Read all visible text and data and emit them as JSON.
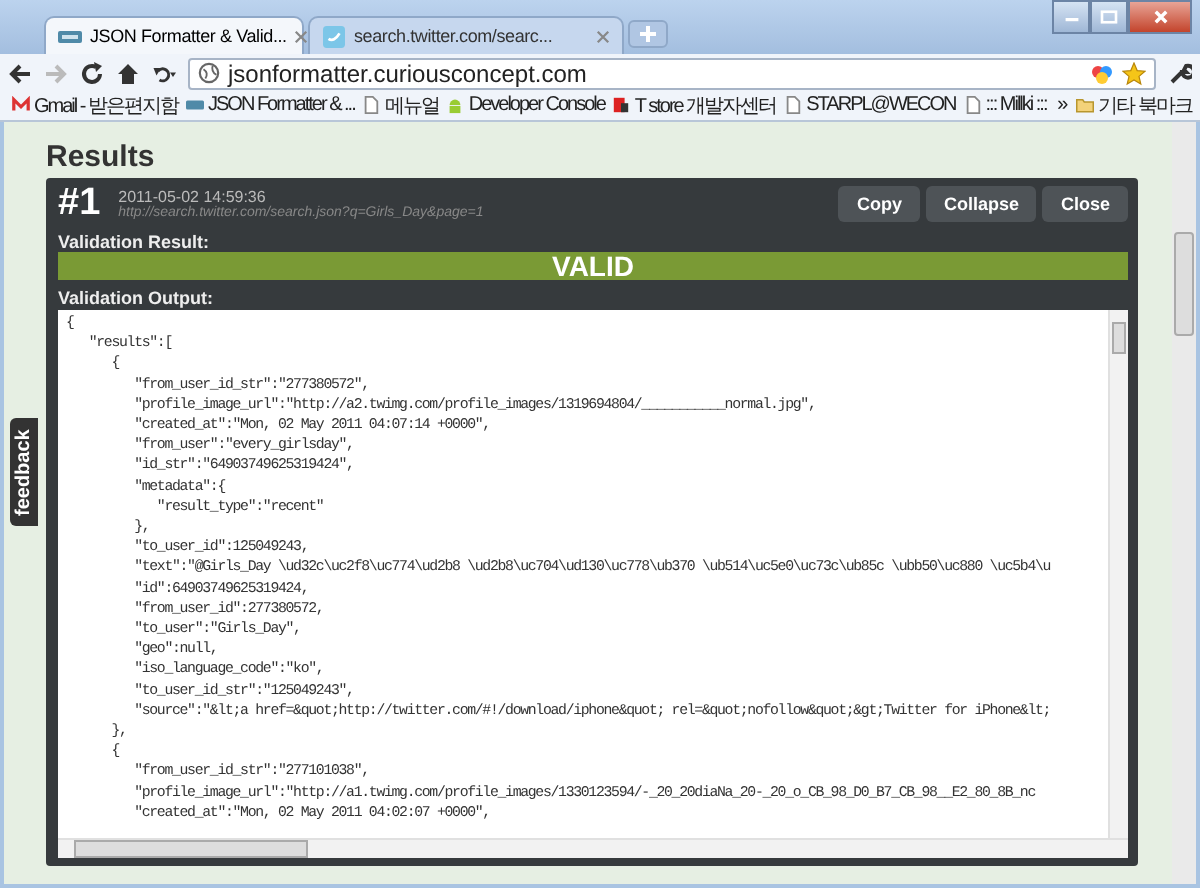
{
  "window": {
    "tabs": [
      {
        "title": "JSON Formatter & Valid...",
        "selected": true
      },
      {
        "title": "search.twitter.com/searc...",
        "selected": false
      }
    ]
  },
  "toolbar": {
    "address": "jsonformatter.curiousconcept.com"
  },
  "bookmarks": {
    "items": [
      "Gmail - 받은편지함",
      "JSON Formatter & ...",
      "메뉴얼",
      "Developer Console",
      "T store 개발자센터",
      "STARPL@WECON",
      "::: Millki :::"
    ],
    "more": "»",
    "other": "기타 북마크"
  },
  "page": {
    "heading": "Results",
    "feedback": "feedback",
    "result": {
      "number": "#1",
      "date": "2011-05-02 14:59:36",
      "url": "http://search.twitter.com/search.json?q=Girls_Day&page=1",
      "buttons": [
        "Copy",
        "Collapse",
        "Close"
      ],
      "validation_label": "Validation Result:",
      "status": "VALID",
      "output_label": "Validation Output:",
      "lines": [
        "{",
        "   \"results\":[",
        "      {",
        "         \"from_user_id_str\":\"277380572\",",
        "         \"profile_image_url\":\"http://a2.twimg.com/profile_images/1319694804/___________normal.jpg\",",
        "         \"created_at\":\"Mon, 02 May 2011 04:07:14 +0000\",",
        "         \"from_user\":\"every_girlsday\",",
        "         \"id_str\":\"64903749625319424\",",
        "         \"metadata\":{",
        "            \"result_type\":\"recent\"",
        "         },",
        "         \"to_user_id\":125049243,",
        "         \"text\":\"@Girls_Day \\ud32c\\uc2f8\\uc774\\ud2b8 \\ud2b8\\uc704\\ud130\\uc778\\ub370 \\ub514\\uc5e0\\uc73c\\ub85c \\ubb50\\uc880 \\uc5b4\\u",
        "         \"id\":64903749625319424,",
        "         \"from_user_id\":277380572,",
        "         \"to_user\":\"Girls_Day\",",
        "         \"geo\":null,",
        "         \"iso_language_code\":\"ko\",",
        "         \"to_user_id_str\":\"125049243\",",
        "         \"source\":\"&lt;a href=&quot;http://twitter.com/#!/download/iphone&quot; rel=&quot;nofollow&quot;&gt;Twitter for iPhone&lt;",
        "      },",
        "      {",
        "         \"from_user_id_str\":\"277101038\",",
        "         \"profile_image_url\":\"http://a1.twimg.com/profile_images/1330123594/-_20_20diaNa_20-_20_o_CB_98_D0_B7_CB_98__E2_80_8B_nc",
        "         \"created_at\":\"Mon, 02 May 2011 04:02:07 +0000\","
      ]
    }
  }
}
